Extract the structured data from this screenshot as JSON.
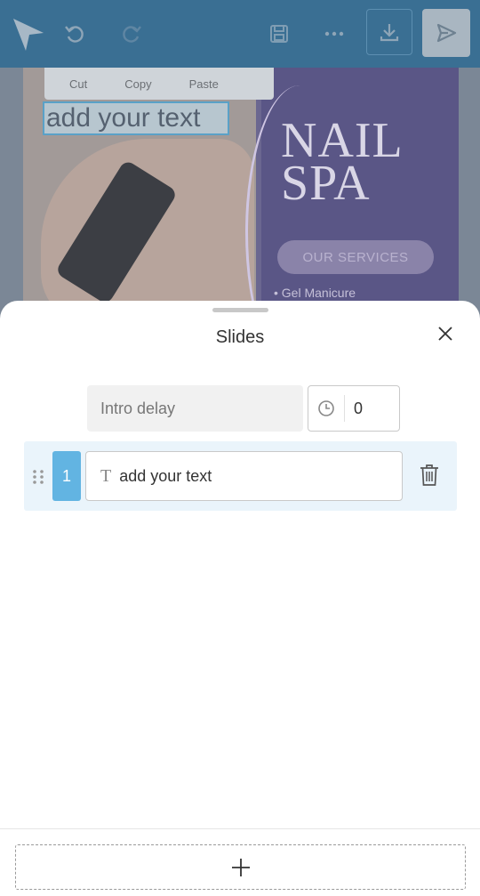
{
  "toolbar": {
    "logo_icon": "logo-arrow-icon",
    "undo_icon": "undo-icon",
    "redo_icon": "redo-icon",
    "save_icon": "save-icon",
    "more_icon": "more-horizontal-icon",
    "download_icon": "download-icon",
    "send_icon": "send-icon"
  },
  "canvas": {
    "context_menu": [
      "Cut",
      "Copy",
      "Paste"
    ],
    "selected_text": "add your text",
    "headline": "NAIL SPA",
    "button_label": "OUR SERVICES",
    "bullet": "• Gel Manicure"
  },
  "sheet": {
    "title": "Slides",
    "close_icon": "close-icon",
    "intro_delay_label": "Intro delay",
    "intro_delay_value": "0",
    "slides": [
      {
        "number": "1",
        "text": "add your text"
      }
    ],
    "add_icon": "plus-icon",
    "colors": {
      "accent": "#62b4e2",
      "row_bg": "#eaf4fb"
    }
  }
}
